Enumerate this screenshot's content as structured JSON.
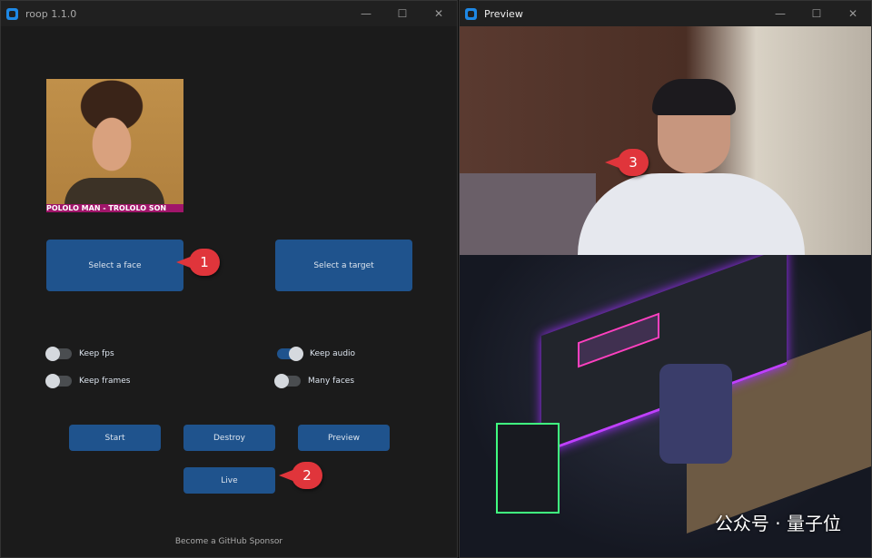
{
  "left_window": {
    "title": "roop 1.1.0",
    "controls": {
      "minimize": "—",
      "maximize": "☐",
      "close": "✕"
    },
    "source_image_caption": "POLOLO MAN - TROLOLO SON",
    "buttons": {
      "select_face": "Select a face",
      "select_target": "Select a target",
      "start": "Start",
      "destroy": "Destroy",
      "preview": "Preview",
      "live": "Live"
    },
    "toggles": [
      {
        "label": "Keep fps",
        "on": false
      },
      {
        "label": "Keep frames",
        "on": false
      },
      {
        "label": "Keep audio",
        "on": true
      },
      {
        "label": "Many faces",
        "on": false
      }
    ],
    "sponsor_link": "Become a GitHub Sponsor"
  },
  "right_window": {
    "title": "Preview",
    "controls": {
      "minimize": "—",
      "maximize": "☐",
      "close": "✕"
    }
  },
  "callouts": [
    "1",
    "2",
    "3"
  ],
  "watermark": "公众号 · 量子位",
  "colors": {
    "accent": "#1f538d",
    "callout": "#e0353b",
    "bg": "#1b1b1b"
  }
}
